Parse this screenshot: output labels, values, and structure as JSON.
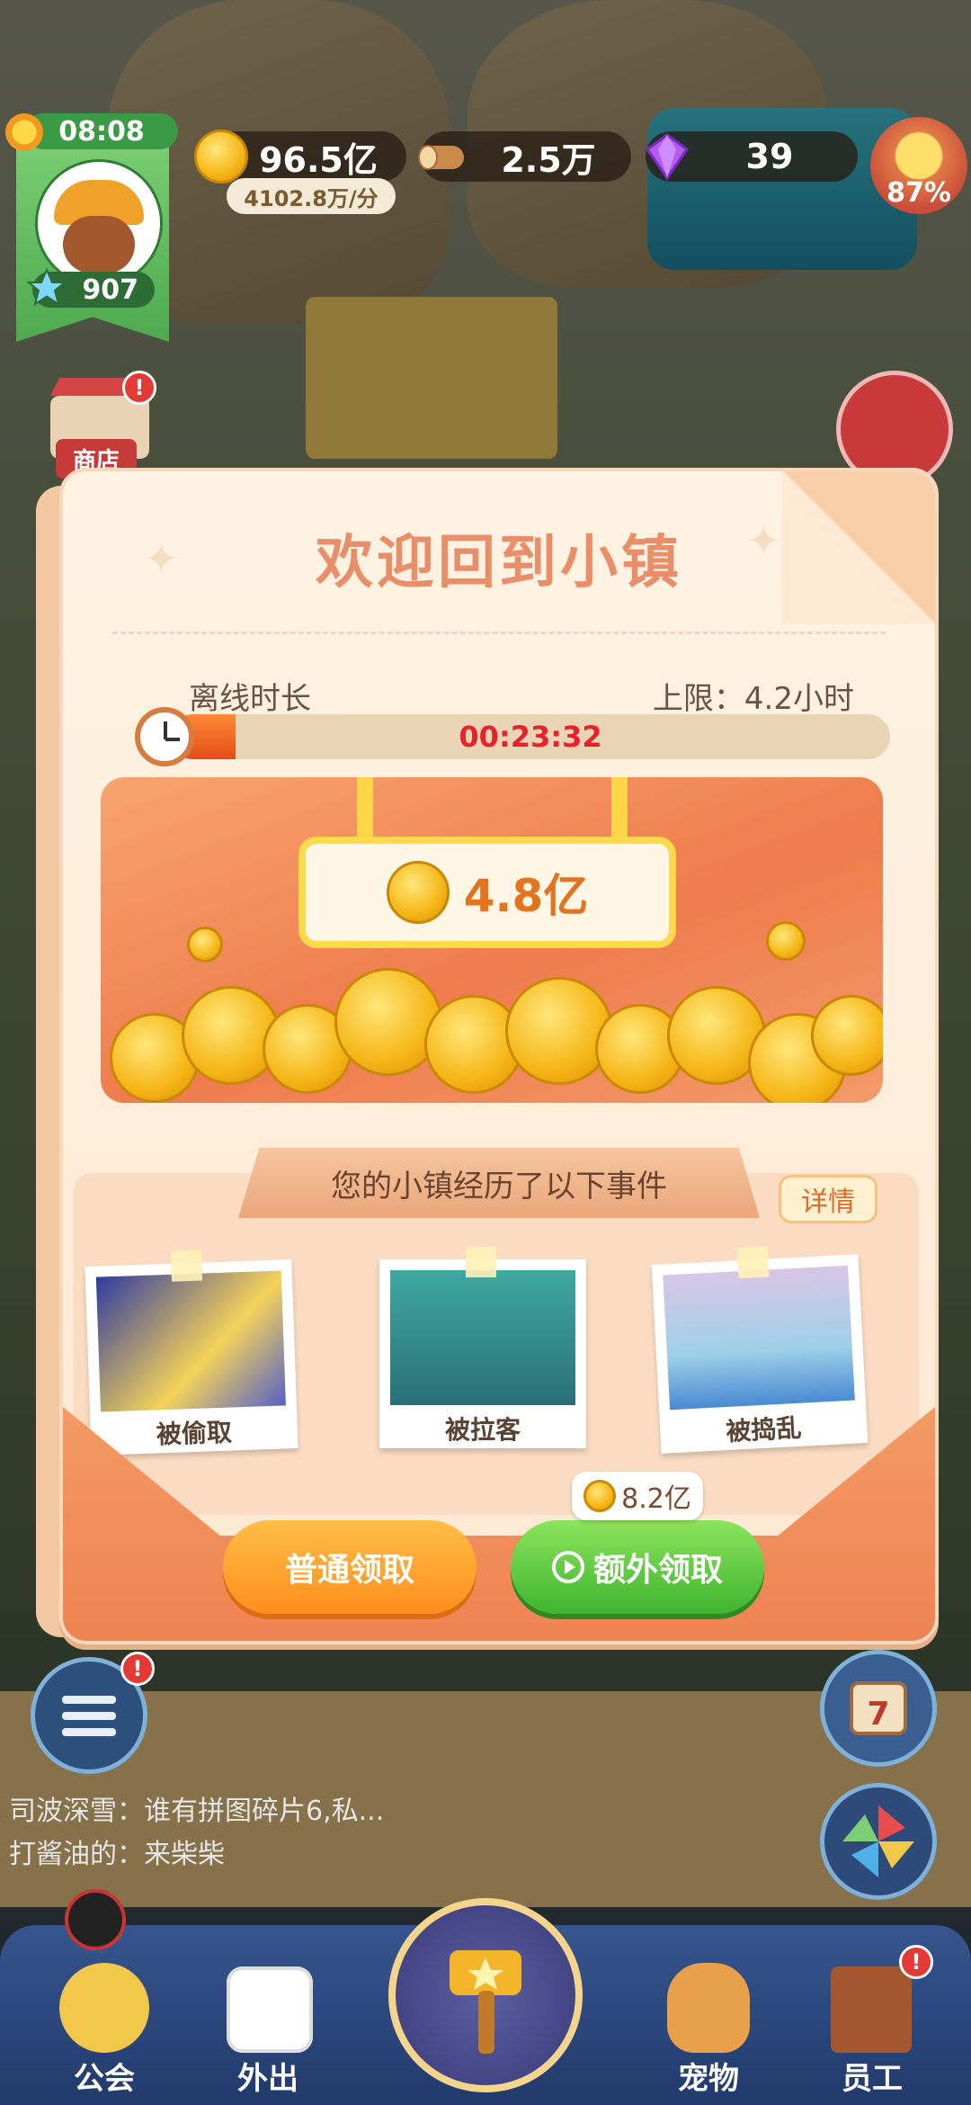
{
  "hud": {
    "time": "08:08",
    "level": "907",
    "coins": "96.5亿",
    "coin_rate": "4102.8万/分",
    "wood": "2.5万",
    "gems": "39",
    "mood": "87%",
    "shop_label": "商店",
    "shop_badge": "!"
  },
  "dialog": {
    "title": "欢迎回到小镇",
    "offline_label": "离线时长",
    "limit_label": "上限：4.2小时",
    "progress_text": "00:23:32",
    "progress_fraction": 0.09,
    "reward_amount": "4.8亿",
    "events_title": "您的小镇经历了以下事件",
    "details_button": "详情",
    "events": [
      {
        "caption": "被偷取",
        "image": "thief-image"
      },
      {
        "caption": "被拉客",
        "image": "truck-image"
      },
      {
        "caption": "被捣乱",
        "image": "boat-image"
      }
    ],
    "normal_claim": "普通领取",
    "extra_claim": "额外领取",
    "extra_bonus": "8.2亿"
  },
  "chat": [
    "司波深雪：谁有拼图碎片6,私...",
    "打酱油的：来柴柴"
  ],
  "nav": {
    "guild": "公会",
    "outing": "外出",
    "pets": "宠物",
    "staff": "员工",
    "staff_badge": "!",
    "menu_badge": "!"
  },
  "colors": {
    "title": "#e88f6a",
    "progress_text": "#e52329",
    "normal_button": "#ff8e1d",
    "extra_button": "#3fb52f"
  }
}
